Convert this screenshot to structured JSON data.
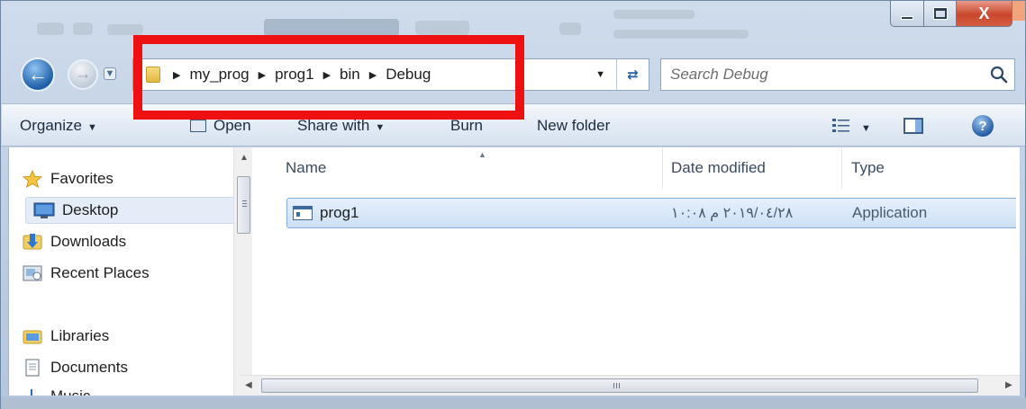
{
  "window": {
    "caption_buttons": {
      "minimize": "minimize",
      "maximize": "maximize",
      "close": "X"
    }
  },
  "address_bar": {
    "crumbs": [
      "my_prog",
      "prog1",
      "bin",
      "Debug"
    ],
    "folder_icon": "folder-icon",
    "refresh_icon": "refresh-icon"
  },
  "search": {
    "placeholder": "Search Debug",
    "icon": "search-icon"
  },
  "toolbar": {
    "organize_label": "Organize",
    "open_label": "Open",
    "share_label": "Share with",
    "burn_label": "Burn",
    "new_folder_label": "New folder",
    "help_label": "?"
  },
  "nav_pane": {
    "items": [
      {
        "label": "Favorites",
        "icon": "star-icon"
      },
      {
        "label": "Desktop",
        "icon": "desktop-icon"
      },
      {
        "label": "Downloads",
        "icon": "downloads-icon"
      },
      {
        "label": "Recent Places",
        "icon": "recent-places-icon"
      },
      {
        "label": "Libraries",
        "icon": "libraries-icon"
      },
      {
        "label": "Documents",
        "icon": "documents-icon"
      },
      {
        "label": "Music",
        "icon": "music-icon"
      }
    ]
  },
  "file_list": {
    "columns": [
      "Name",
      "Date modified",
      "Type"
    ],
    "rows": [
      {
        "name": "prog1",
        "date_modified": "٢٠١٩/٠٤/٢٨ م ١٠:٠٨",
        "type": "Application"
      }
    ]
  },
  "colors": {
    "highlight": "#ef1111",
    "selection_border": "#84acdd",
    "chrome": "#bccde2"
  }
}
